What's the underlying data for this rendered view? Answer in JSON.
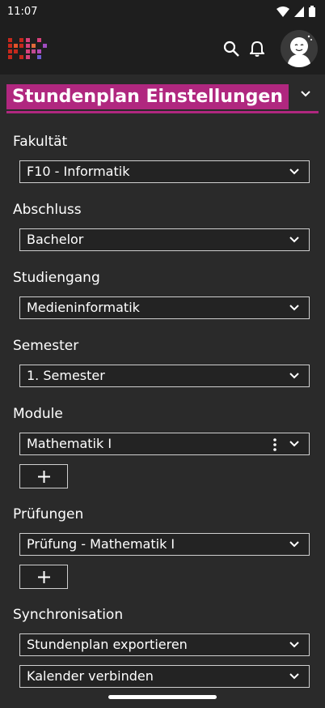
{
  "status": {
    "time": "11:07"
  },
  "header": {
    "title": "Stundenplan Einstellungen"
  },
  "fields": {
    "fakultaet": {
      "label": "Fakultät",
      "value": "F10 - Informatik"
    },
    "abschluss": {
      "label": "Abschluss",
      "value": "Bachelor"
    },
    "studiengang": {
      "label": "Studiengang",
      "value": "Medieninformatik"
    },
    "semester": {
      "label": "Semester",
      "value": "1. Semester"
    },
    "module": {
      "label": "Module",
      "value": "Mathematik I",
      "add_label": "+"
    },
    "pruefungen": {
      "label": "Prüfungen",
      "value": "Prüfung - Mathematik I",
      "add_label": "+"
    },
    "sync": {
      "label": "Synchronisation",
      "export": "Stundenplan exportieren",
      "calendar": "Kalender verbinden"
    }
  },
  "colors": {
    "accent": "#b0277f",
    "background": "#2a2a2a",
    "bar": "#1e1e1e"
  }
}
